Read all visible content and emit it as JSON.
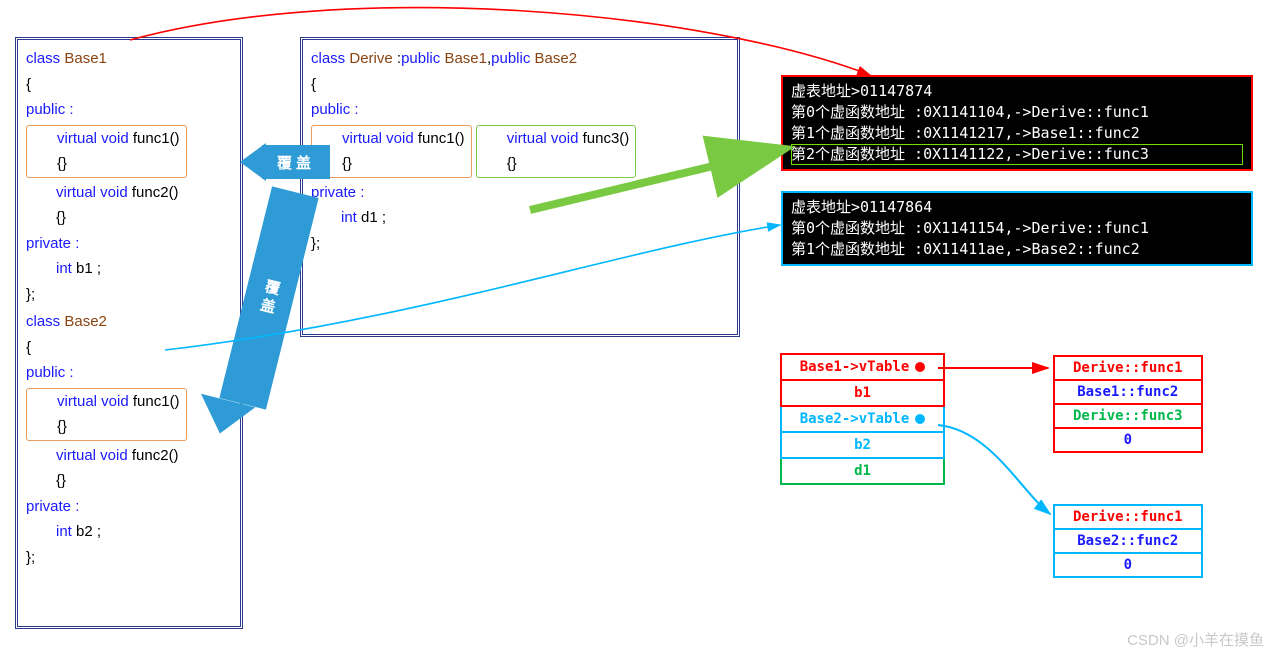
{
  "base1": {
    "header": "class Base1",
    "public": "public :",
    "func1": "virtual void func1()",
    "func1b": "{}",
    "func2": "virtual void func2()",
    "func2b": "{}",
    "private": "private :",
    "member": "int b1 ;",
    "close": "};"
  },
  "base2": {
    "header": "class Base2",
    "public": "public :",
    "func1": "virtual void func1()",
    "func1b": "{}",
    "func2": "virtual void func2()",
    "func2b": "{}",
    "private": "private :",
    "member": "int b2 ;",
    "close": "};"
  },
  "derive": {
    "header": "class Derive :public Base1,public Base2",
    "public": "public :",
    "func1": "virtual void func1()",
    "func1b": "{}",
    "func3": "virtual void func3()",
    "func3b": "{}",
    "private": "private :",
    "member": "int d1 ;",
    "close": "};"
  },
  "label_override1": "覆盖",
  "label_override2": "覆盖",
  "console1": {
    "l0": "虚表地址>01147874",
    "l1": "第0个虚函数地址 :0X1141104,->Derive::func1",
    "l2": "第1个虚函数地址 :0X1141217,->Base1::func2",
    "l3": "第2个虚函数地址 :0X1141122,->Derive::func3"
  },
  "console2": {
    "l0": "虚表地址>01147864",
    "l1": "第0个虚函数地址 :0X1141154,->Derive::func1",
    "l2": "第1个虚函数地址 :0X11411ae,->Base2::func2"
  },
  "layout": {
    "r0": "Base1->vTable",
    "r1": "b1",
    "r2": "Base2->vTable",
    "r3": "b2",
    "r4": "d1"
  },
  "vtable1": {
    "r0": "Derive::func1",
    "r1": "Base1::func2",
    "r2": "Derive::func3",
    "r3": "0"
  },
  "vtable2": {
    "r0": "Derive::func1",
    "r1": "Base2::func2",
    "r2": "0"
  },
  "colors": {
    "red": "#ff0000",
    "cyan": "#00b7ff",
    "green": "#00b84c",
    "blue": "#1a1aff"
  },
  "watermark": "CSDN @小羊在摸鱼"
}
